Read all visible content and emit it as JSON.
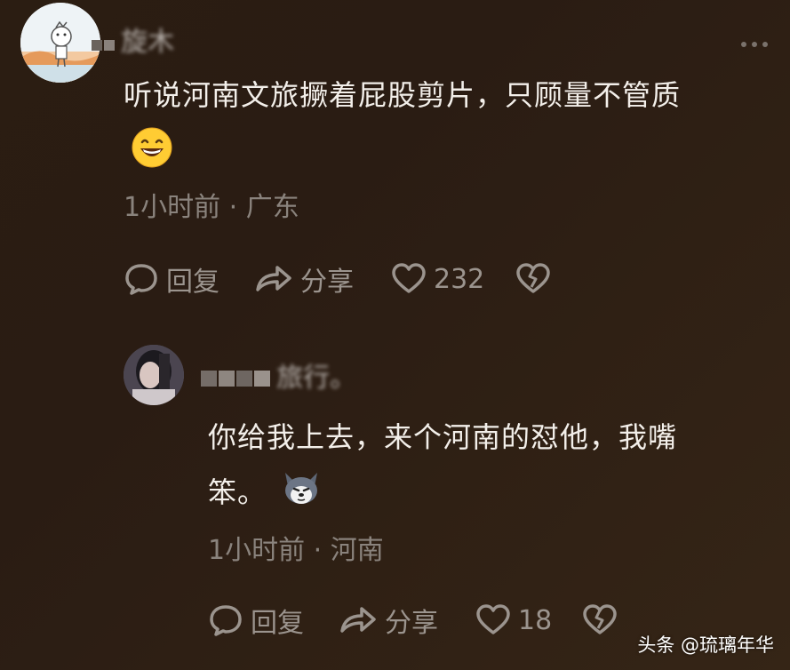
{
  "comments": [
    {
      "username": "旋木",
      "text_line1": "听说河南文旅撅着屁股剪片，只顾量不管质",
      "time": "1小时前",
      "location": "广东",
      "reply_label": "回复",
      "share_label": "分享",
      "like_count": "232",
      "emoji": "grinning-face"
    },
    {
      "username": "旅行。",
      "text_line1": "你给我上去，来个河南的怼他，我嘴",
      "text_line2": "笨。",
      "time": "1小时前",
      "location": "河南",
      "reply_label": "回复",
      "share_label": "分享",
      "like_count": "18",
      "emoji": "husky-dog-face"
    }
  ],
  "separator": "·",
  "watermark": "头条 @琉璃年华",
  "colors": {
    "background": "#2b1d12",
    "text": "#f3efea",
    "muted": "#8a837d",
    "action": "#9b948e"
  }
}
